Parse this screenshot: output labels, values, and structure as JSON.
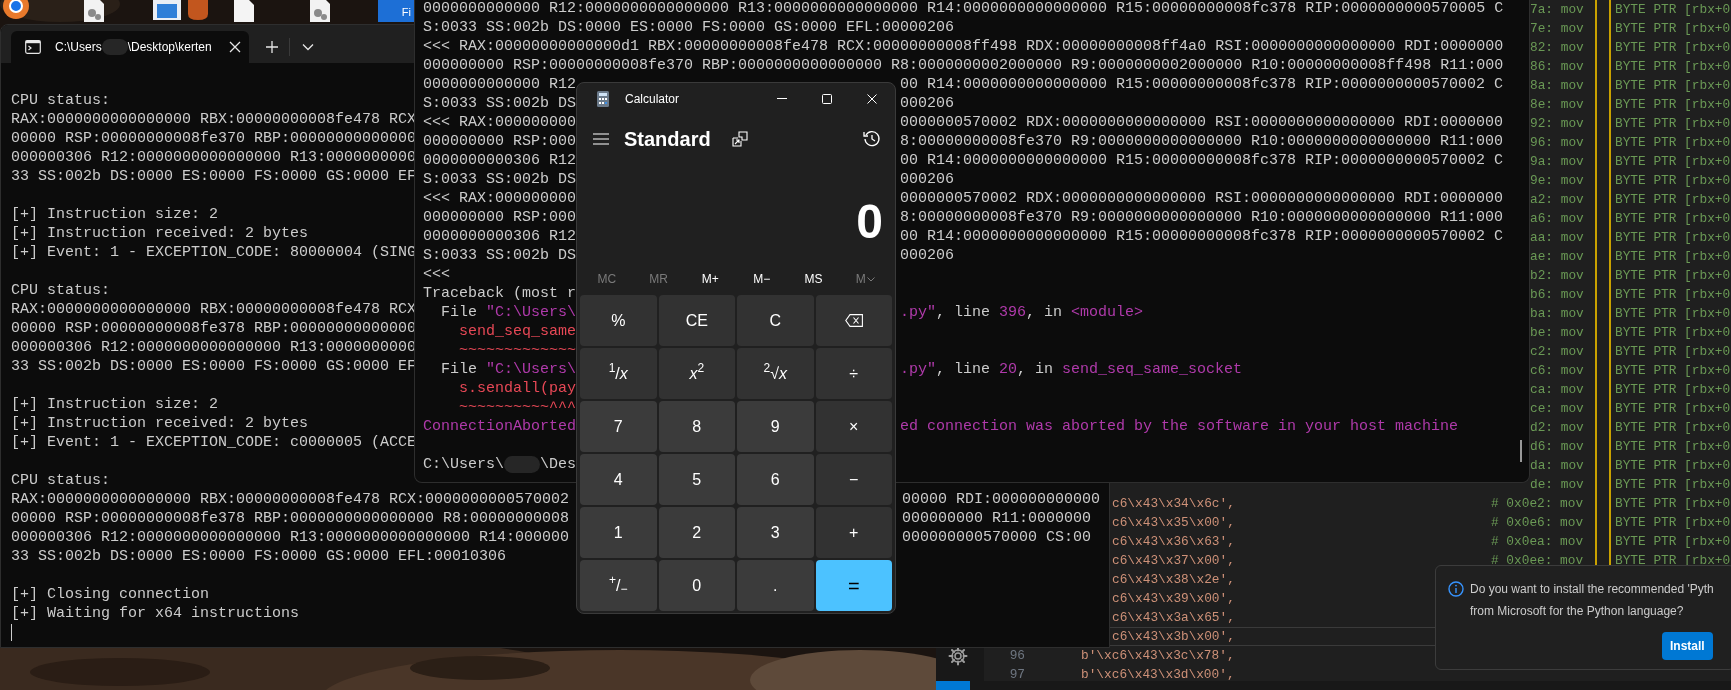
{
  "desktop_icons": [
    {
      "kind": "browser"
    },
    {
      "kind": "settings-file"
    },
    {
      "kind": "window-file"
    },
    {
      "kind": "app"
    },
    {
      "kind": "blank-file"
    },
    {
      "kind": "settings-file"
    },
    {
      "kind": "shortcut",
      "label": "Fi"
    }
  ],
  "editor": {
    "lines": [
      {
        "kind": "covered",
        "comment": "7a: mov",
        "operand": "BYTE PTR [rbx+0"
      },
      {
        "kind": "covered",
        "comment": "7e: mov",
        "operand": "BYTE PTR [rbx+0"
      },
      {
        "kind": "covered",
        "comment": "82: mov",
        "operand": "BYTE PTR [rbx+0"
      },
      {
        "kind": "covered",
        "comment": "86: mov",
        "operand": "BYTE PTR [rbx+0"
      },
      {
        "kind": "covered",
        "comment": "8a: mov",
        "operand": "BYTE PTR [rbx+0"
      },
      {
        "kind": "covered",
        "comment": "8e: mov",
        "operand": "BYTE PTR [rbx+0"
      },
      {
        "kind": "covered",
        "comment": "92: mov",
        "operand": "BYTE PTR [rbx+0"
      },
      {
        "kind": "covered",
        "comment": "96: mov",
        "operand": "BYTE PTR [rbx+0"
      },
      {
        "kind": "covered",
        "comment": "9a: mov",
        "operand": "BYTE PTR [rbx+0"
      },
      {
        "kind": "covered",
        "comment": "9e: mov",
        "operand": "BYTE PTR [rbx+0"
      },
      {
        "kind": "covered",
        "comment": "a2: mov",
        "operand": "BYTE PTR [rbx+0"
      },
      {
        "kind": "covered",
        "comment": "a6: mov",
        "operand": "BYTE PTR [rbx+0"
      },
      {
        "kind": "covered",
        "comment": "aa: mov",
        "operand": "BYTE PTR [rbx+0"
      },
      {
        "kind": "covered",
        "comment": "ae: mov",
        "operand": "BYTE PTR [rbx+0"
      },
      {
        "kind": "covered",
        "comment": "b2: mov",
        "operand": "BYTE PTR [rbx+0"
      },
      {
        "kind": "covered",
        "comment": "b6: mov",
        "operand": "BYTE PTR [rbx+0"
      },
      {
        "kind": "covered",
        "comment": "ba: mov",
        "operand": "BYTE PTR [rbx+0"
      },
      {
        "kind": "covered",
        "comment": "be: mov",
        "operand": "BYTE PTR [rbx+0"
      },
      {
        "kind": "covered",
        "comment": "c2: mov",
        "operand": "BYTE PTR [rbx+0"
      },
      {
        "kind": "covered",
        "comment": "c6: mov",
        "operand": "BYTE PTR [rbx+0"
      },
      {
        "kind": "covered",
        "comment": "ca: mov",
        "operand": "BYTE PTR [rbx+0"
      },
      {
        "kind": "covered",
        "comment": "ce: mov",
        "operand": "BYTE PTR [rbx+0"
      },
      {
        "kind": "covered",
        "comment": "d2: mov",
        "operand": "BYTE PTR [rbx+0"
      },
      {
        "kind": "covered",
        "comment": "d6: mov",
        "operand": "BYTE PTR [rbx+0"
      },
      {
        "kind": "covered",
        "comment": "da: mov",
        "operand": "BYTE PTR [rbx+0"
      },
      {
        "kind": "covered",
        "comment": "de: mov",
        "operand": "BYTE PTR [rbx+0"
      },
      {
        "kind": "partly",
        "code": "c6\\x43\\x34\\x6c',",
        "comment": "# 0x0e2: mov",
        "operand": "BYTE PTR [rbx+0",
        "current": false
      },
      {
        "kind": "partly",
        "code": "c6\\x43\\x35\\x00',",
        "comment": "# 0x0e6: mov",
        "operand": "BYTE PTR [rbx+0",
        "current": false
      },
      {
        "kind": "partly",
        "code": "c6\\x43\\x36\\x63',",
        "comment": "# 0x0ea: mov",
        "operand": "BYTE PTR [rbx+0",
        "current": false
      },
      {
        "kind": "partly",
        "code": "c6\\x43\\x37\\x00',",
        "comment": "# 0x0ee: mov",
        "operand": "BYTE PTR [rbx+0",
        "current": false
      },
      {
        "kind": "partly",
        "code": "c6\\x43\\x38\\x2e',",
        "current": false
      },
      {
        "kind": "partly",
        "code": "c6\\x43\\x39\\x00',",
        "current": false
      },
      {
        "kind": "partly",
        "code": "c6\\x43\\x3a\\x65',",
        "current": false
      },
      {
        "kind": "partly",
        "code": "c6\\x43\\x3b\\x00',",
        "current": true
      },
      {
        "kind": "full",
        "number": "96",
        "code": "b'\\xc6\\x43\\x3c\\x78',",
        "current": false
      },
      {
        "kind": "full",
        "number": "97",
        "code": "b'\\xc6\\x43\\x3d\\x00',",
        "current": false
      }
    ],
    "notification": {
      "lines": [
        "Do you want to install the recommended 'Pyth",
        "from Microsoft for the Python language?"
      ],
      "button": "Install"
    }
  },
  "left_terminal": {
    "tab": {
      "title_start": "C:\\Users",
      "title_end": "\\Desktop\\kerten"
    },
    "lines": [
      {
        "kind": "text",
        "text": "CPU status:"
      },
      {
        "kind": "text",
        "text": "RAX:0000000000000000 RBX:00000000008fe478 RCX"
      },
      {
        "kind": "text",
        "text": "00000 RSP:00000000008fe370 RBP:00000000000000"
      },
      {
        "kind": "text",
        "text": "000000306 R12:0000000000000000 R13:0000000000"
      },
      {
        "kind": "text",
        "text": "33 SS:002b DS:0000 ES:0000 FS:0000 GS:0000 EF"
      },
      {
        "kind": "blank"
      },
      {
        "kind": "text",
        "text": "[+] Instruction size: 2"
      },
      {
        "kind": "text",
        "text": "[+] Instruction received: 2 bytes"
      },
      {
        "kind": "text",
        "text": "[+] Event: 1 - EXCEPTION_CODE: 80000004 (SING"
      },
      {
        "kind": "blank"
      },
      {
        "kind": "text",
        "text": "CPU status:"
      },
      {
        "kind": "text",
        "text": "RAX:0000000000000000 RBX:00000000008fe478 RCX"
      },
      {
        "kind": "text",
        "text": "00000 RSP:00000000008fe378 RBP:00000000000000"
      },
      {
        "kind": "text",
        "text": "000000306 R12:0000000000000000 R13:0000000000"
      },
      {
        "kind": "text",
        "text": "33 SS:002b DS:0000 ES:0000 FS:0000 GS:0000 EF"
      },
      {
        "kind": "blank"
      },
      {
        "kind": "text",
        "text": "[+] Instruction size: 2"
      },
      {
        "kind": "text",
        "text": "[+] Instruction received: 2 bytes"
      },
      {
        "kind": "text",
        "text": "[+] Event: 1 - EXCEPTION_CODE: c0000005 (ACCE"
      },
      {
        "kind": "blank"
      },
      {
        "kind": "text",
        "text": "CPU status:"
      },
      {
        "kind": "split",
        "text": "RAX:0000000000000000 RBX:00000000008fe478 RCX:0000000000570002",
        "right": "00000 RDI:000000000000"
      },
      {
        "kind": "split",
        "text": "00000 RSP:00000000008fe378 RBP:0000000000000000 R8:00000000008",
        "right": "000000000 R11:0000000"
      },
      {
        "kind": "split",
        "text": "000000306 R12:0000000000000000 R13:0000000000000000 R14:000000",
        "right": "000000000570000 CS:00"
      },
      {
        "kind": "text",
        "text": "33 SS:002b DS:0000 ES:0000 FS:0000 GS:0000 EFL:00010306"
      },
      {
        "kind": "blank"
      },
      {
        "kind": "text",
        "text": "[+] Closing connection"
      },
      {
        "kind": "text",
        "text": "[+] Waiting for x64 instructions"
      },
      {
        "kind": "cursor"
      }
    ]
  },
  "right_terminal": {
    "lines": [
      {
        "kind": "text",
        "spans": [
          {
            "t": "0000000000000 R12:0000000000000000 R13:0000000000000000 R14:0000000000000000 R15:00000000008fc378 RIP:0000000000570005 C",
            "color": "#cccccc"
          }
        ]
      },
      {
        "kind": "text",
        "spans": [
          {
            "t": "S:0033 SS:002b DS:0000 ES:0000 FS:0000 GS:0000 EFL:00000206",
            "color": "#cccccc"
          }
        ]
      },
      {
        "kind": "text",
        "spans": [
          {
            "t": "<<< RAX:00000000000000d1 RBX:00000000008fe478 RCX:00000000008ff498 RDX:00000000008ff4a0 RSI:0000000000000000 RDI:0000000",
            "color": "#cccccc"
          }
        ]
      },
      {
        "kind": "text",
        "spans": [
          {
            "t": "000000000 RSP:00000000008fe370 RBP:0000000000000000 R8:0000000002000000 R9:0000000002000000 R10:00000000008ff498 R11:000",
            "color": "#cccccc"
          }
        ]
      },
      {
        "kind": "split",
        "spans": [
          {
            "t": "0000000000000 R12",
            "color": "#cccccc"
          }
        ],
        "right": [
          {
            "t": "00 R14:0000000000000000 R15:00000000008fc378 RIP:0000000000570002 C",
            "color": "#cccccc"
          }
        ]
      },
      {
        "kind": "split",
        "spans": [
          {
            "t": "S:0033 SS:002b DS",
            "color": "#cccccc"
          }
        ],
        "right": [
          {
            "t": "000206",
            "color": "#cccccc"
          }
        ]
      },
      {
        "kind": "split",
        "spans": [
          {
            "t": "<<< RAX:000000000",
            "color": "#cccccc"
          }
        ],
        "right": [
          {
            "t": "0000000570002 RDX:0000000000000000 RSI:0000000000000000 RDI:0000000",
            "color": "#cccccc"
          }
        ]
      },
      {
        "kind": "split",
        "spans": [
          {
            "t": "000000000 RSP:000",
            "color": "#cccccc"
          }
        ],
        "right": [
          {
            "t": "8:00000000008fe370 R9:0000000000000000 R10:0000000000000000 R11:000",
            "color": "#cccccc"
          }
        ]
      },
      {
        "kind": "split",
        "spans": [
          {
            "t": "0000000000306 R12",
            "color": "#cccccc"
          }
        ],
        "right": [
          {
            "t": "00 R14:0000000000000000 R15:00000000008fc378 RIP:0000000000570002 C",
            "color": "#cccccc"
          }
        ]
      },
      {
        "kind": "split",
        "spans": [
          {
            "t": "S:0033 SS:002b DS",
            "color": "#cccccc"
          }
        ],
        "right": [
          {
            "t": "000206",
            "color": "#cccccc"
          }
        ]
      },
      {
        "kind": "split",
        "spans": [
          {
            "t": "<<< RAX:000000000",
            "color": "#cccccc"
          }
        ],
        "right": [
          {
            "t": "0000000570002 RDX:0000000000000000 RSI:0000000000000000 RDI:0000000",
            "color": "#cccccc"
          }
        ]
      },
      {
        "kind": "split",
        "spans": [
          {
            "t": "000000000 RSP:000",
            "color": "#cccccc"
          }
        ],
        "right": [
          {
            "t": "8:00000000008fe370 R9:0000000000000000 R10:0000000000000000 R11:000",
            "color": "#cccccc"
          }
        ]
      },
      {
        "kind": "split",
        "spans": [
          {
            "t": "0000000000306 R12",
            "color": "#cccccc"
          }
        ],
        "right": [
          {
            "t": "00 R14:0000000000000000 R15:00000000008fc378 RIP:0000000000570002 C",
            "color": "#cccccc"
          }
        ]
      },
      {
        "kind": "split",
        "spans": [
          {
            "t": "S:0033 SS:002b DS",
            "color": "#cccccc"
          }
        ],
        "right": [
          {
            "t": "000206",
            "color": "#cccccc"
          }
        ]
      },
      {
        "kind": "text",
        "spans": [
          {
            "t": "<<<",
            "color": "#cccccc"
          }
        ]
      },
      {
        "kind": "text",
        "spans": [
          {
            "t": "Traceback (most r",
            "color": "#cccccc"
          }
        ]
      },
      {
        "kind": "split",
        "spans": [
          {
            "t": "  File ",
            "color": "#cccccc"
          },
          {
            "t": "\"C:\\Users\\",
            "color": "#b03aab"
          }
        ],
        "right": [
          {
            "t": ".py\"",
            "color": "#b03aab"
          },
          {
            "t": ", line ",
            "color": "#cccccc"
          },
          {
            "t": "396",
            "color": "#b03aab"
          },
          {
            "t": ", in ",
            "color": "#cccccc"
          },
          {
            "t": "<module>",
            "color": "#b03aab"
          }
        ]
      },
      {
        "kind": "text",
        "spans": [
          {
            "t": "    send_seq_same",
            "color": "#e74856"
          }
        ]
      },
      {
        "kind": "text",
        "spans": [
          {
            "t": "    ~~~~~~~~~~~~~",
            "color": "#e74856"
          }
        ]
      },
      {
        "kind": "split",
        "spans": [
          {
            "t": "  File ",
            "color": "#cccccc"
          },
          {
            "t": "\"C:\\Users\\",
            "color": "#b03aab"
          }
        ],
        "right": [
          {
            "t": ".py\"",
            "color": "#b03aab"
          },
          {
            "t": ", line ",
            "color": "#cccccc"
          },
          {
            "t": "20",
            "color": "#b03aab"
          },
          {
            "t": ", in ",
            "color": "#cccccc"
          },
          {
            "t": "send_seq_same_socket",
            "color": "#b03aab"
          }
        ]
      },
      {
        "kind": "text",
        "spans": [
          {
            "t": "    s.sendall(pay",
            "color": "#e74856"
          }
        ]
      },
      {
        "kind": "text",
        "spans": [
          {
            "t": "    ~~~~~~~~~~^^^",
            "color": "#e74856"
          }
        ]
      },
      {
        "kind": "split",
        "spans": [
          {
            "t": "ConnectionAborted",
            "color": "#b03aab"
          }
        ],
        "right": [
          {
            "t": "ed connection was aborted by the software in your host machine",
            "color": "#b03aab"
          }
        ]
      },
      {
        "kind": "blank"
      },
      {
        "kind": "prompt",
        "start": "C:\\Users\\",
        "end": "\\Des"
      }
    ]
  },
  "calculator": {
    "title": "Calculator",
    "mode": "Standard",
    "display": "0",
    "memory": [
      {
        "label": "MC",
        "disabled": true,
        "kind": "text"
      },
      {
        "label": "MR",
        "disabled": true,
        "kind": "text"
      },
      {
        "label": "M+",
        "disabled": false,
        "kind": "text"
      },
      {
        "label": "M−",
        "disabled": false,
        "kind": "text"
      },
      {
        "label": "MS",
        "disabled": false,
        "kind": "text"
      },
      {
        "label": "M",
        "disabled": true,
        "kind": "dropdown"
      }
    ],
    "keys": [
      {
        "label": "%",
        "kind": "function"
      },
      {
        "label": "CE",
        "kind": "function"
      },
      {
        "label": "C",
        "kind": "function"
      },
      {
        "kind": "backspace"
      },
      {
        "label": "$^{1}$/*x*",
        "kind": "function"
      },
      {
        "label": "*x*$^{2}$",
        "kind": "function"
      },
      {
        "label": "$^{2}$√*x*",
        "kind": "function"
      },
      {
        "label": "÷",
        "kind": "function"
      },
      {
        "label": "7",
        "kind": "digit"
      },
      {
        "label": "8",
        "kind": "digit"
      },
      {
        "label": "9",
        "kind": "digit"
      },
      {
        "label": "×",
        "kind": "function"
      },
      {
        "label": "4",
        "kind": "digit"
      },
      {
        "label": "5",
        "kind": "digit"
      },
      {
        "label": "6",
        "kind": "digit"
      },
      {
        "label": "−",
        "kind": "function"
      },
      {
        "label": "1",
        "kind": "digit"
      },
      {
        "label": "2",
        "kind": "digit"
      },
      {
        "label": "3",
        "kind": "digit"
      },
      {
        "label": "+",
        "kind": "function"
      },
      {
        "label": "$^{+}$/$_{−}$",
        "kind": "digit"
      },
      {
        "label": "0",
        "kind": "digit"
      },
      {
        "label": ".",
        "kind": "digit"
      },
      {
        "label": "=",
        "kind": "equals"
      }
    ]
  }
}
